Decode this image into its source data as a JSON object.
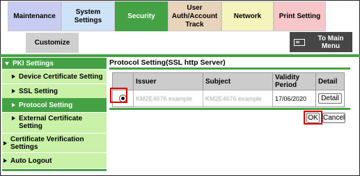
{
  "tabs": [
    "Maintenance",
    "System Settings",
    "Security",
    "User Auth/Account Track",
    "Network",
    "Print Setting"
  ],
  "tabs_row2": [
    "Customize"
  ],
  "main_menu": {
    "label": "To Main Menu",
    "icon": "main-menu-icon"
  },
  "sidebar": {
    "group": "PKI Settings",
    "items": [
      "Device Certificate Setting",
      "SSL Setting",
      "Protocol Setting",
      "External Certificate Setting"
    ],
    "other": [
      "Certificate Verification Settings",
      "Auto Logout"
    ]
  },
  "content": {
    "title": "Protocol Setting(SSL http Server)",
    "columns": [
      "",
      "Issuer",
      "Subject",
      "Validity Period",
      "Detail"
    ],
    "rows": [
      {
        "selected": true,
        "issuer": "KM2E4676 example",
        "subject": "KM2E4676 example",
        "validity": "17/06/2020",
        "detail": "Detail"
      }
    ]
  },
  "buttons": {
    "ok": "OK",
    "cancel": "Cancel"
  },
  "colors": {
    "accent": "#44a244",
    "sidebar_bg": "#c9f1a8",
    "highlight": "#e00000"
  }
}
